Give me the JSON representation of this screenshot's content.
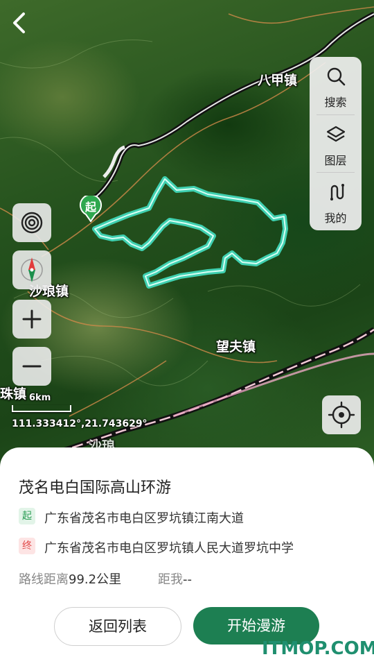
{
  "map": {
    "places": [
      {
        "name": "八甲镇"
      },
      {
        "name": "沙琅镇"
      },
      {
        "name": "望夫镇"
      },
      {
        "name": "珠镇"
      },
      {
        "name": "沙琅"
      }
    ],
    "start_marker": "起",
    "scale": "6km",
    "coordinates": "111.333412°,21.743629°"
  },
  "toolbar": {
    "search_label": "搜索",
    "layers_label": "图层",
    "mine_label": "我的"
  },
  "route": {
    "title": "茂名电白国际高山环游",
    "start_tag": "起",
    "start_address": "广东省茂名市电白区罗坑镇江南大道",
    "end_tag": "终",
    "end_address": "广东省茂名市电白区罗坑镇人民大道罗坑中学",
    "distance_label": "路线距离",
    "distance_value": "99.2公里",
    "from_me_label": "距我",
    "from_me_value": "--"
  },
  "actions": {
    "back_to_list": "返回列表",
    "start_tour": "开始漫游"
  },
  "watermark": "ITMOP.COM",
  "colors": {
    "route": "#3fd0b0",
    "primary_button": "#1d7f52",
    "start_marker": "#2ea84f"
  }
}
